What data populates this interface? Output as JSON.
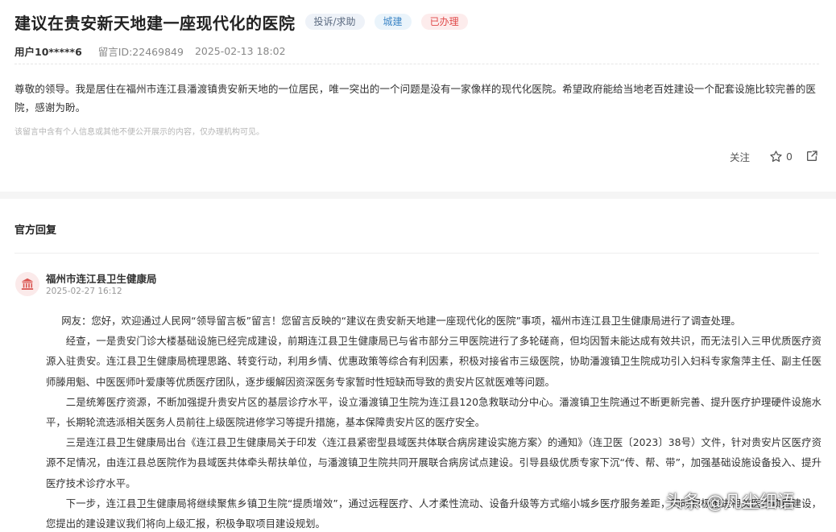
{
  "message": {
    "title": "建议在贵安新天地建一座现代化的医院",
    "tags": {
      "type": "投诉/求助",
      "domain": "城建",
      "status": "已办理"
    },
    "user": "用户10*****6",
    "message_id": "留言ID:22469849",
    "datetime": "2025-02-13 18:02",
    "body": "尊敬的领导。我是居住在福州市连江县潘渡镇贵安新天地的一位居民，唯一突出的一个问题是没有一家像样的现代化医院。希望政府能给当地老百姓建设一个配套设施比较完善的医院，感谢为盼。",
    "privacy_note": "该留言中含有个人信息或其他不便公开展示的内容，仅办理机构可见。",
    "actions": {
      "follow": "关注",
      "star_count": "0"
    }
  },
  "reply": {
    "section_title": "官方回复",
    "org_name": "福州市连江县卫生健康局",
    "date": "2025-02-27 16:12",
    "paragraphs": [
      "网友：您好，欢迎通过人民网“领导留言板”留言！您留言反映的“建议在贵安新天地建一座现代化的医院”事项，福州市连江县卫生健康局进行了调查处理。",
      "经查，一是贵安门诊大楼基础设施已经完成建设，前期连江县卫生健康局已与省市部分三甲医院进行了多轮磋商，但均因暂未能达成有效共识，而无法引入三甲优质医疗资源入驻贵安。连江县卫生健康局梳理思路、转变行动，利用乡情、优惠政策等综合有利因素，积极对接省市三级医院，协助潘渡镇卫生院成功引入妇科专家詹萍主任、副主任医师滕用魁、中医医师叶爱康等优质医疗团队，逐步缓解因资深医务专家暂时性短缺而导致的贵安片区就医难等问题。",
      "二是统筹医疗资源，不断加强提升贵安片区的基层诊疗水平，设立潘渡镇卫生院为连江县120急救联动分中心。潘渡镇卫生院通过不断更新完善、提升医疗护理硬件设施水平，长期轮流选派相关医务人员前往上级医院进修学习等提升措施，基本保障贵安片区的医疗安全。",
      "三是连江县卫生健康局出台《连江县卫生健康局关于印发〈连江县紧密型县域医共体联合病房建设实施方案〉的通知》（连卫医〔2023〕38号）文件，针对贵安片区医疗资源不足情况，由连江县总医院作为县域医共体牵头帮扶单位，与潘渡镇卫生院共同开展联合病房试点建设。引导县级优质专家下沉“传、帮、带”，加强基础设施设备投入、提升医疗技术诊疗水平。",
      "下一步，连江县卫生健康局将继续聚焦乡镇卫生院“提质增效”，通过远程医疗、人才柔性流动、设备升级等方式缩小城乡医疗服务差距，同时积极推进相关医疗项目建设，您提出的建设建议我们将向上级汇报，积极争取项目建设规划。"
    ]
  },
  "watermark": "头条 @凡尘细语",
  "icons": {
    "star": "star-icon",
    "share": "share-icon",
    "org": "government-building-icon"
  },
  "colors": {
    "tag_type_text": "#5c6b80",
    "tag_domain_text": "#3d86c6",
    "tag_status_text": "#e04a4a",
    "org_icon": "#d9534f"
  }
}
